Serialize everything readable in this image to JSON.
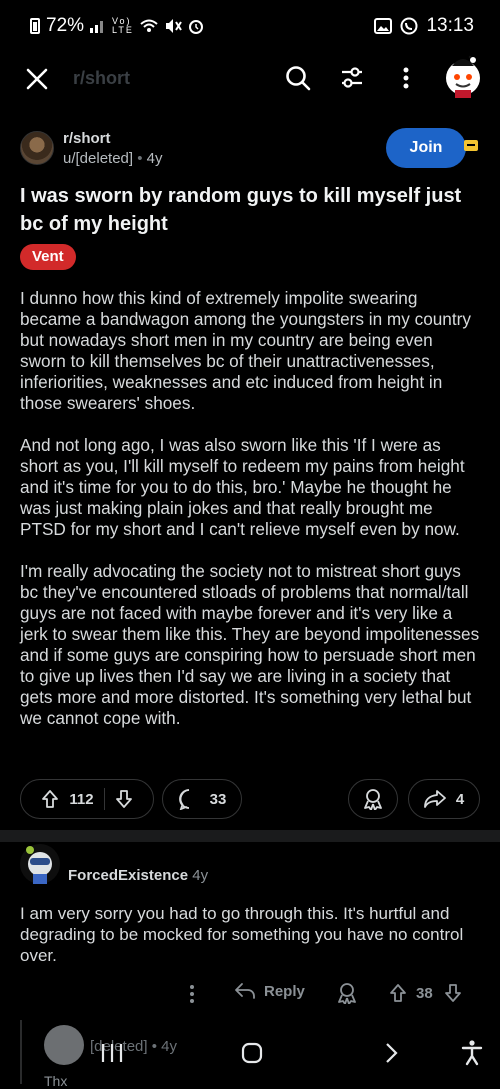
{
  "status_bar": {
    "battery": "72%",
    "network": "Vo) LTE",
    "time": "13:13"
  },
  "app_bar": {
    "subreddit_faded": "r/short"
  },
  "post": {
    "subreddit": "r/short",
    "author": "u/[deleted]",
    "age": "4y",
    "join_label": "Join",
    "title": "I was sworn by random guys to kill myself just bc of my height",
    "flair": "Vent",
    "paragraphs": [
      "I dunno how this kind of extremely impolite swearing became a bandwagon among the youngsters in my country but nowadays short men in my country are being even sworn to kill themselves bc of their unattractivenesses, inferiorities, weaknesses and etc induced from height in those swearers' shoes.",
      "And not long ago, I was also sworn like this 'If I were as short as you, I'll kill myself to redeem my pains from height and it's time for you to do this, bro.' Maybe he thought he was just making plain jokes and that really brought me PTSD for my short and I can't relieve myself even by now.",
      "I'm really advocating the society not to mistreat short guys bc they've encountered stloads of problems that normal/tall guys are not faced with maybe forever and it's very like a jerk to swear them like this. They are beyond impolitenesses and if some guys are conspiring how to persuade short men to give up lives then I'd say we are living in a society that gets more and more distorted. It's something very lethal but we cannot cope with."
    ],
    "votes": "112",
    "comments": "33",
    "shares": "4"
  },
  "comment": {
    "author": "ForcedExistence",
    "age": "4y",
    "body": "I am very sorry you had to go through this. It's hurtful and degrading to be mocked for something you have no control over.",
    "reply_label": "Reply",
    "votes": "38"
  },
  "reply": {
    "author": "[deleted]",
    "age": "4y",
    "body_preview": "Thx"
  },
  "colors": {
    "accent": "#1d64c8",
    "flair": "#d22a2a",
    "background": "#000000"
  }
}
